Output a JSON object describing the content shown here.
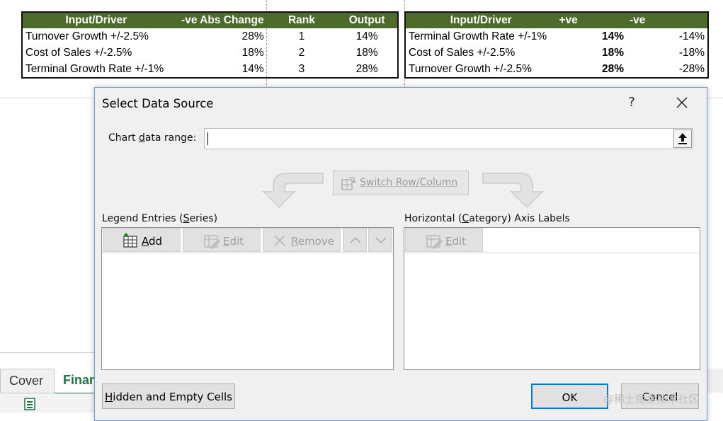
{
  "left_table": {
    "headers": [
      "Input/Driver",
      "-ve Abs Change",
      "Rank",
      "Output"
    ],
    "rows": [
      [
        "Turnover Growth +/-2.5%",
        "28%",
        "1",
        "14%"
      ],
      [
        "Cost of Sales +/-2.5%",
        "18%",
        "2",
        "18%"
      ],
      [
        "Terminal Growth Rate +/-1%",
        "14%",
        "3",
        "28%"
      ]
    ]
  },
  "right_table": {
    "headers": [
      "Input/Driver",
      "+ve",
      "-ve"
    ],
    "rows": [
      [
        "Terminal Growth Rate +/-1%",
        "14%",
        "-14%"
      ],
      [
        "Cost of Sales +/-2.5%",
        "18%",
        "-18%"
      ],
      [
        "Turnover Growth +/-2.5%",
        "28%",
        "-28%"
      ]
    ]
  },
  "colors": {
    "header_bg": "#4d6b2a",
    "dialog_border": "#6d9bd0",
    "ok_border": "#0078d7"
  },
  "dialog": {
    "title": "Select Data Source",
    "help": "?",
    "chart_range_label_pre": "Chart ",
    "chart_range_label_key": "d",
    "chart_range_label_post": "ata range:",
    "chart_range_value": "",
    "switch_label": "Switch Row/Column",
    "legend_title_pre": "Legend Entries (",
    "legend_title_key": "S",
    "legend_title_post": "eries)",
    "add_key": "A",
    "add_rest": "dd",
    "edit_key": "E",
    "edit_rest": "dit",
    "remove_key": "R",
    "remove_rest": "emove",
    "axis_title_pre": "Horizontal (",
    "axis_title_key": "C",
    "axis_title_post": "ategory) Axis Labels",
    "axis_edit_key": "E",
    "axis_edit_rest": "dit",
    "hidden_key": "H",
    "hidden_rest": "idden and Empty Cells",
    "ok": "OK",
    "cancel": "Cancel"
  },
  "sheet_tabs": [
    "Cover",
    "Finar"
  ],
  "watermark": "@稀土掘金技术社区"
}
